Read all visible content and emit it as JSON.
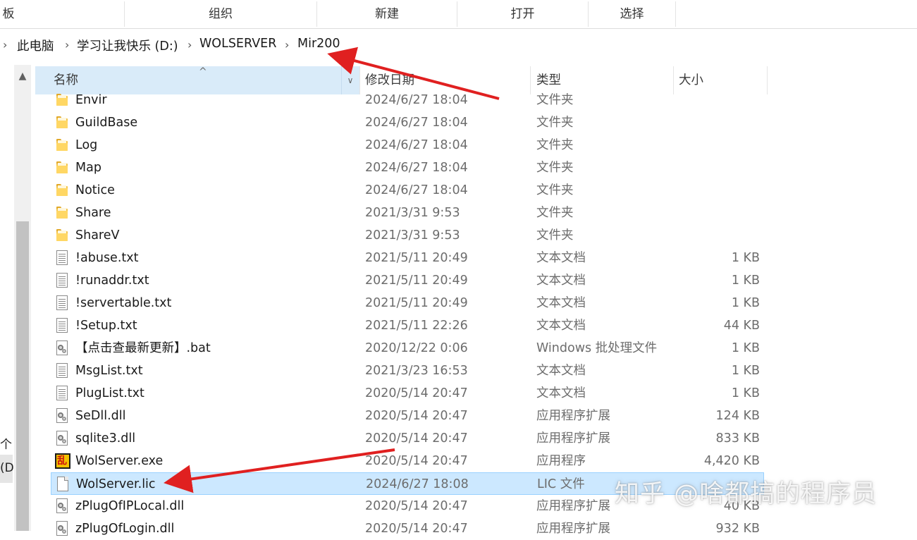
{
  "ribbon": {
    "clipboard_fragment": "板",
    "groups": [
      "组织",
      "新建",
      "打开",
      "选择"
    ]
  },
  "address": {
    "crumbs": [
      "此电脑",
      "学习让我快乐 (D:)",
      "WOLSERVER",
      "Mir200"
    ]
  },
  "nav_pane": {
    "fragment_1": "个",
    "fragment_2": "(D"
  },
  "columns": {
    "name": "名称",
    "date": "修改日期",
    "type": "类型",
    "size": "大小"
  },
  "files": [
    {
      "name": "Envir",
      "date": "2024/6/27 18:04",
      "type": "文件夹",
      "size": "",
      "icon": "folder-icon"
    },
    {
      "name": "GuildBase",
      "date": "2024/6/27 18:04",
      "type": "文件夹",
      "size": "",
      "icon": "folder-icon"
    },
    {
      "name": "Log",
      "date": "2024/6/27 18:04",
      "type": "文件夹",
      "size": "",
      "icon": "folder-icon"
    },
    {
      "name": "Map",
      "date": "2024/6/27 18:04",
      "type": "文件夹",
      "size": "",
      "icon": "folder-icon"
    },
    {
      "name": "Notice",
      "date": "2024/6/27 18:04",
      "type": "文件夹",
      "size": "",
      "icon": "folder-icon"
    },
    {
      "name": "Share",
      "date": "2021/3/31 9:53",
      "type": "文件夹",
      "size": "",
      "icon": "folder-icon"
    },
    {
      "name": "ShareV",
      "date": "2021/3/31 9:53",
      "type": "文件夹",
      "size": "",
      "icon": "folder-icon"
    },
    {
      "name": "!abuse.txt",
      "date": "2021/5/11 20:49",
      "type": "文本文档",
      "size": "1 KB",
      "icon": "text-file-icon"
    },
    {
      "name": "!runaddr.txt",
      "date": "2021/5/11 20:49",
      "type": "文本文档",
      "size": "1 KB",
      "icon": "text-file-icon"
    },
    {
      "name": "!servertable.txt",
      "date": "2021/5/11 20:49",
      "type": "文本文档",
      "size": "1 KB",
      "icon": "text-file-icon"
    },
    {
      "name": "!Setup.txt",
      "date": "2021/5/11 22:26",
      "type": "文本文档",
      "size": "44 KB",
      "icon": "text-file-icon"
    },
    {
      "name": "【点击查最新更新】.bat",
      "date": "2020/12/22 0:06",
      "type": "Windows 批处理文件",
      "size": "1 KB",
      "icon": "batch-file-icon"
    },
    {
      "name": "MsgList.txt",
      "date": "2021/3/23 16:53",
      "type": "文本文档",
      "size": "1 KB",
      "icon": "text-file-icon"
    },
    {
      "name": "PlugList.txt",
      "date": "2020/5/14 20:47",
      "type": "文本文档",
      "size": "1 KB",
      "icon": "text-file-icon"
    },
    {
      "name": "SeDll.dll",
      "date": "2020/5/14 20:47",
      "type": "应用程序扩展",
      "size": "124 KB",
      "icon": "dll-file-icon"
    },
    {
      "name": "sqlite3.dll",
      "date": "2020/5/14 20:47",
      "type": "应用程序扩展",
      "size": "833 KB",
      "icon": "dll-file-icon"
    },
    {
      "name": "WolServer.exe",
      "date": "2020/5/14 20:47",
      "type": "应用程序",
      "size": "4,420 KB",
      "icon": "exe-app-icon"
    },
    {
      "name": "WolServer.lic",
      "date": "2024/6/27 18:08",
      "type": "LIC 文件",
      "size": "",
      "icon": "blank-file-icon",
      "selected": true
    },
    {
      "name": "zPlugOfIPLocal.dll",
      "date": "2020/5/14 20:47",
      "type": "应用程序扩展",
      "size": "40 KB",
      "icon": "dll-file-icon"
    },
    {
      "name": "zPlugOfLogin.dll",
      "date": "2020/5/14 20:47",
      "type": "应用程序扩展",
      "size": "932 KB",
      "icon": "dll-file-icon"
    }
  ],
  "annotation_color": "#e02020",
  "selection_color": "#cce8ff",
  "header_highlight_color": "#d9ebf9",
  "watermark": "知乎 @啥都搞的程序员"
}
